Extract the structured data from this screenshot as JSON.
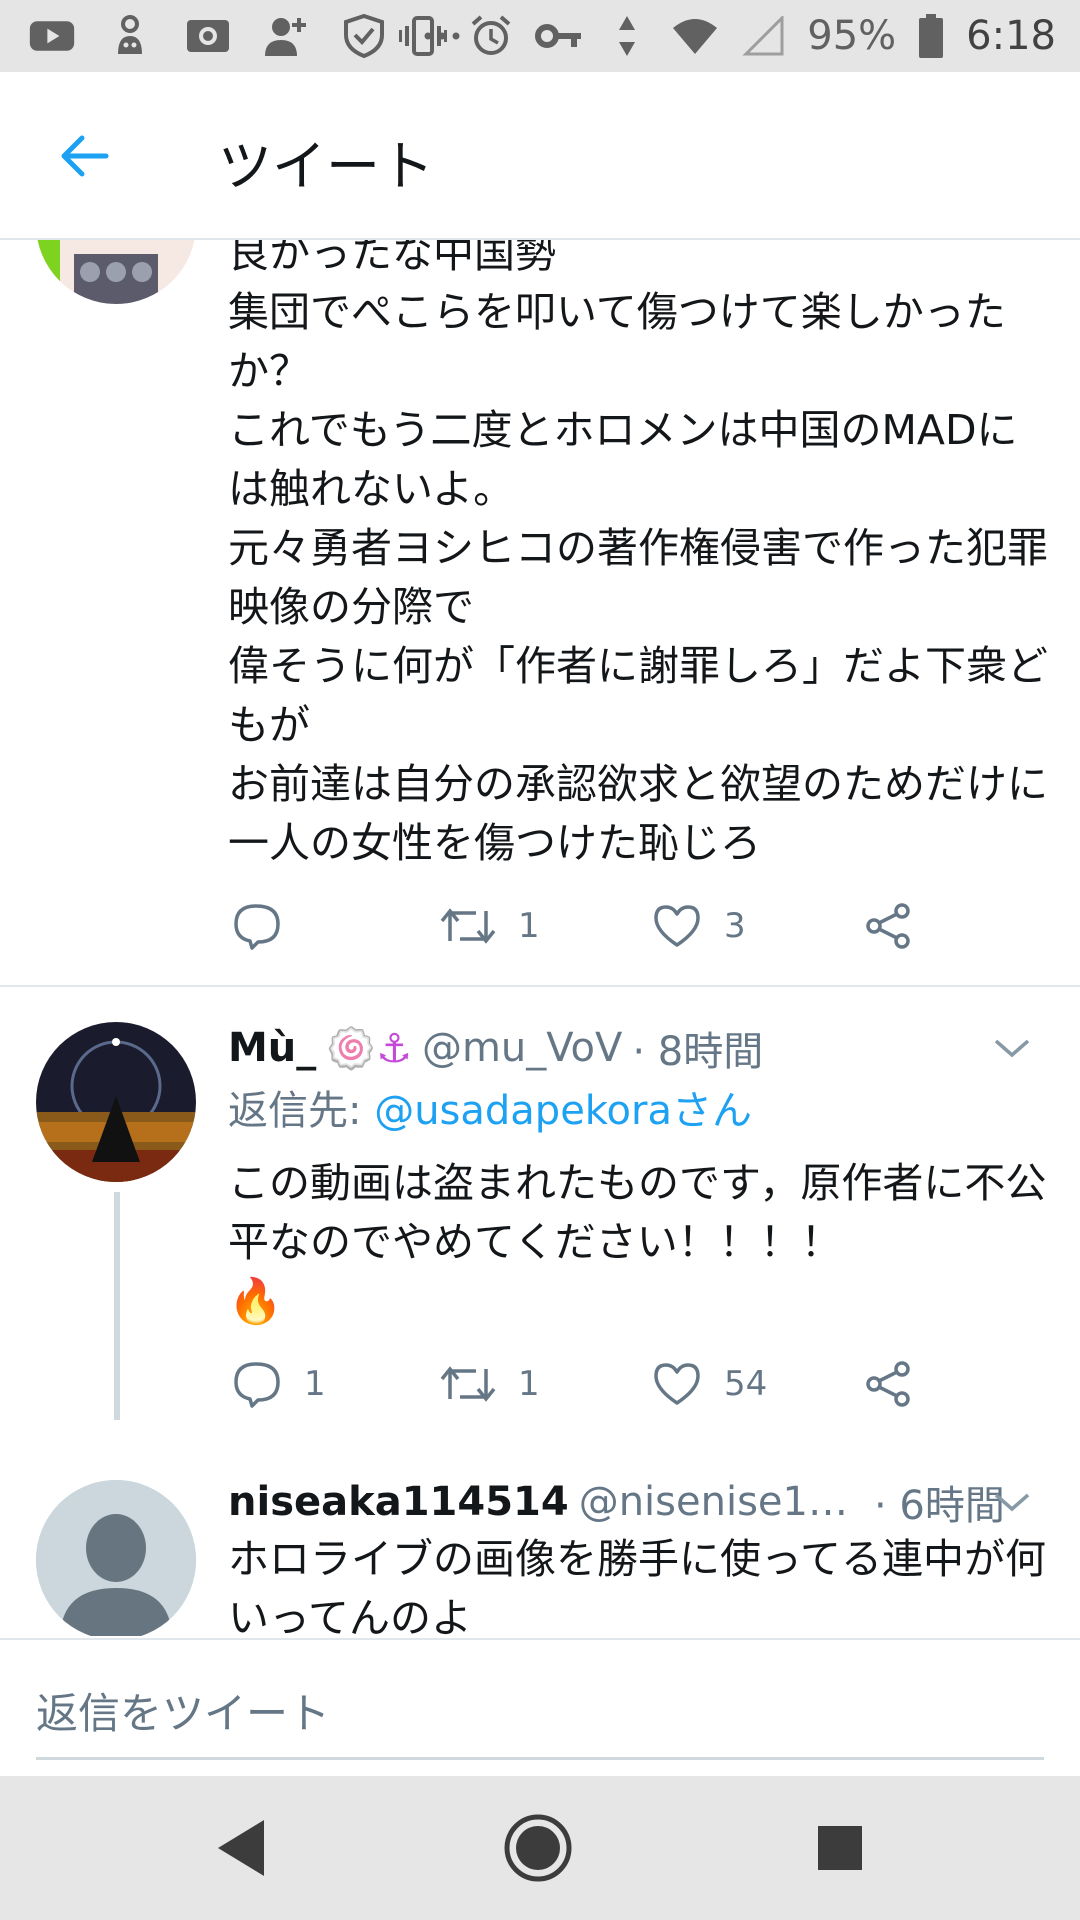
{
  "status_bar": {
    "battery": "95%",
    "time": "6:18",
    "left_icons": [
      "youtube-icon",
      "cat-icon",
      "camera-icon",
      "add-person-icon",
      "shield-icon",
      "more-icon"
    ],
    "right_icons": [
      "vibrate-icon",
      "alarm-icon",
      "key-icon",
      "data-arrows-icon",
      "wifi-icon",
      "signal-icon",
      "battery-icon"
    ]
  },
  "app_bar": {
    "title": "ツイート"
  },
  "tweets": [
    {
      "text": "良かったな中国勢\n集団でぺこらを叩いて傷つけて楽しかったか？\nこれでもう二度とホロメンは中国のMADには触れないよ。\n元々勇者ヨシヒコの著作権侵害で作った犯罪映像の分際で\n偉そうに何が「作者に謝罪しろ」だよ下衆どもが\nお前達は自分の承認欲求と欲望のためだけに一人の女性を傷つけた恥じろ",
      "replies": "",
      "retweets": "1",
      "likes": "3"
    },
    {
      "name": "Mù_",
      "name_emojis": "🍥⚓",
      "handle": "@mu_VoV",
      "time": "· 8時間",
      "reply_prefix": "返信先: ",
      "reply_to": "@usadapekoraさん",
      "text": "この動画は盗まれたものです，原作者に不公平なのでやめてください！！！！",
      "emoji": "🔥",
      "replies": "1",
      "retweets": "1",
      "likes": "54"
    },
    {
      "name": "niseaka114514",
      "handle": "@nisenise1…",
      "time": "· 6時間",
      "text": "ホロライブの画像を勝手に使ってる連中が何いってんのよ"
    }
  ],
  "compose": {
    "placeholder": "返信をツイート"
  },
  "colors": {
    "accent": "#1da1f2",
    "secondary_text": "#657786",
    "divider": "#e1e8ed"
  }
}
